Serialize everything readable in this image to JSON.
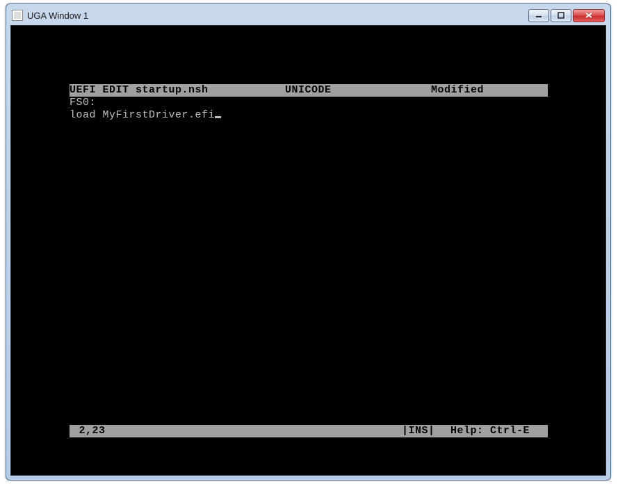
{
  "window": {
    "title": "UGA Window 1"
  },
  "editor": {
    "header": {
      "app_file": "UEFI EDIT startup.nsh",
      "encoding": "UNICODE",
      "status": "Modified"
    },
    "lines": [
      "FS0:",
      "load MyFirstDriver.efi"
    ],
    "footer": {
      "cursor_pos": " 2,23",
      "mode": "|INS|",
      "help": "Help: Ctrl-E"
    }
  }
}
